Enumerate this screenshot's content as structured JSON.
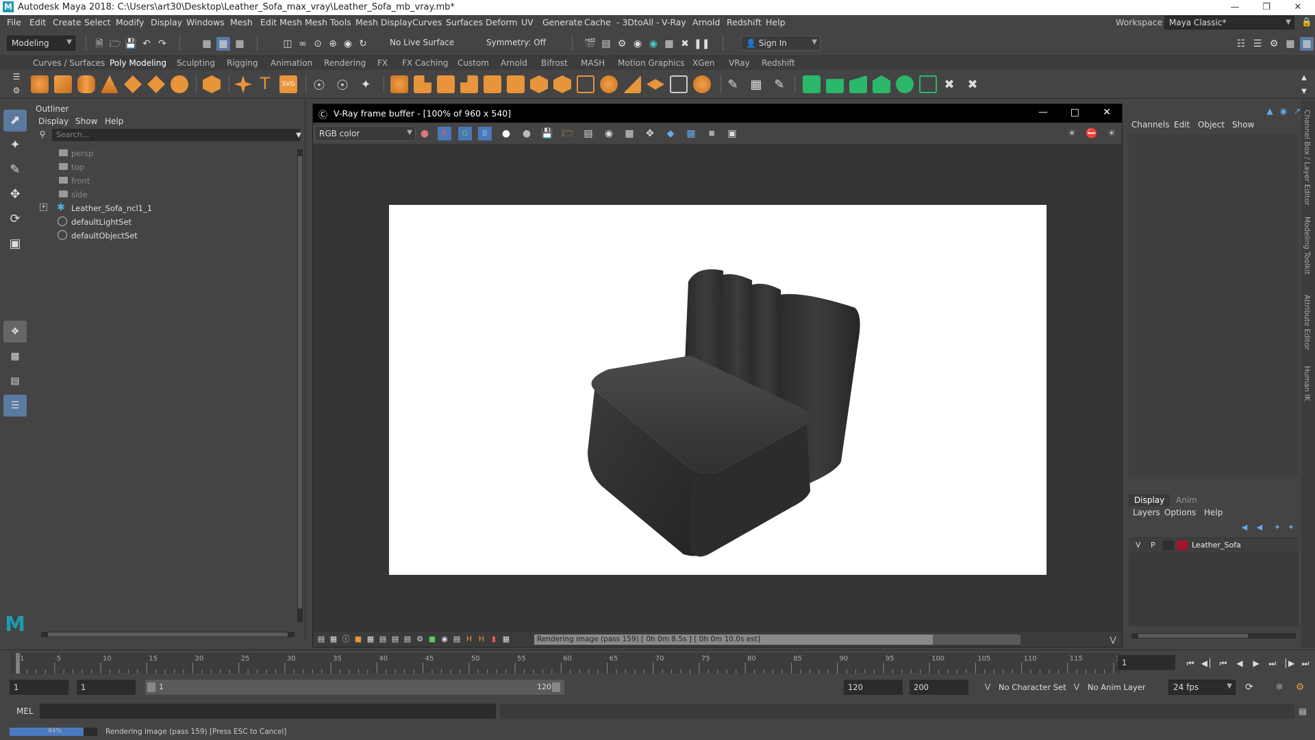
{
  "window": {
    "title": "Autodesk Maya 2018: C:\\Users\\art30\\Desktop\\Leather_Sofa_max_vray\\Leather_Sofa_mb_vray.mb*",
    "logo": "M"
  },
  "menubar": [
    "File",
    "Edit",
    "Create",
    "Select",
    "Modify",
    "Display",
    "Windows",
    "Mesh",
    "Edit Mesh",
    "Mesh Tools",
    "Mesh Display",
    "Curves",
    "Surfaces",
    "Deform",
    "UV",
    "Generate",
    "Cache",
    "- 3DtoAll -",
    "V-Ray",
    "Arnold",
    "Redshift",
    "Help"
  ],
  "workspace": {
    "label": "Workspace :",
    "value": "Maya Classic*"
  },
  "statusline": {
    "mode": "Modeling",
    "live_surface": "No Live Surface",
    "symmetry": "Symmetry: Off",
    "sign_in": "Sign In"
  },
  "shelf_tabs": [
    "Curves / Surfaces",
    "Poly Modeling",
    "Sculpting",
    "Rigging",
    "Animation",
    "Rendering",
    "FX",
    "FX Caching",
    "Custom",
    "Arnold",
    "Bifrost",
    "MASH",
    "Motion Graphics",
    "XGen",
    "VRay",
    "Redshift"
  ],
  "shelf_active": "Poly Modeling",
  "shelf_icon_colors": {
    "poly": "#e8943a",
    "accent": "#2bb86a"
  },
  "outliner": {
    "title": "Outliner",
    "menus": [
      "Display",
      "Show",
      "Help"
    ],
    "search_placeholder": "Search...",
    "items": [
      {
        "label": "persp",
        "type": "camera",
        "dim": true
      },
      {
        "label": "top",
        "type": "camera",
        "dim": true
      },
      {
        "label": "front",
        "type": "camera",
        "dim": true
      },
      {
        "label": "side",
        "type": "camera",
        "dim": true
      },
      {
        "label": "Leather_Sofa_ncl1_1",
        "type": "group",
        "dim": false
      },
      {
        "label": "defaultLightSet",
        "type": "set",
        "dim": false
      },
      {
        "label": "defaultObjectSet",
        "type": "set",
        "dim": false
      }
    ]
  },
  "vfb": {
    "title": "V-Ray frame buffer - [100% of 960 x 540]",
    "channel": "RGB color",
    "r": "R",
    "g": "G",
    "b": "B",
    "progress_text": "Rendering image (pass 159) [ 0h  0m  8.5s ] [ 0h  0m 10.0s est]",
    "progress": 0.82
  },
  "channel_box": {
    "menus": [
      "Channels",
      "Edit",
      "Object",
      "Show"
    ]
  },
  "layers": {
    "tabs": [
      "Display",
      "Anim"
    ],
    "menus": [
      "Layers",
      "Options",
      "Help"
    ],
    "layer": {
      "v": "V",
      "p": "P",
      "name": "Leather_Sofa",
      "color": "#a5142a"
    }
  },
  "side_tabs": [
    "Channel Box / Layer Editor",
    "Modeling Toolkit",
    "Attribute Editor",
    "Human IK"
  ],
  "timeline": {
    "ticks": [
      "1",
      "5",
      "10",
      "15",
      "20",
      "25",
      "30",
      "35",
      "40",
      "45",
      "50",
      "55",
      "60",
      "65",
      "70",
      "75",
      "80",
      "85",
      "90",
      "95",
      "100",
      "105",
      "110",
      "115",
      "120"
    ],
    "current_frame": "1"
  },
  "range": {
    "start": "1",
    "anim_start": "1",
    "slider_start": "1",
    "slider_end": "120",
    "end": "120",
    "anim_end": "200",
    "character_set": "No Character Set",
    "anim_layer": "No Anim Layer",
    "fps": "24 fps"
  },
  "cmdline": {
    "label": "MEL"
  },
  "help": {
    "percent": "84%",
    "progress": 0.84,
    "text": "Rendering image (pass 159) [Press ESC to Cancel]"
  }
}
